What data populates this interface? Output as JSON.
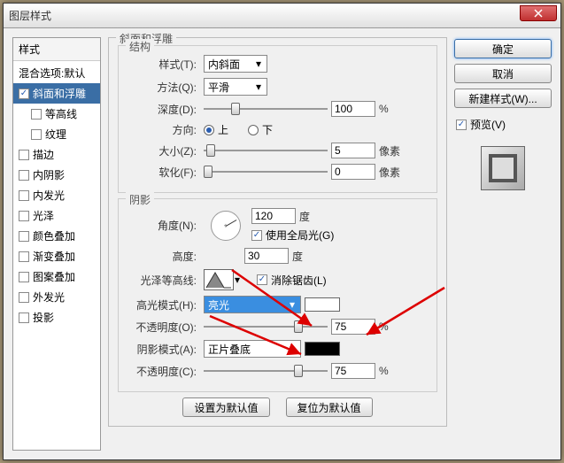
{
  "window": {
    "title": "图层样式"
  },
  "left": {
    "header": "样式",
    "items": [
      {
        "label": "混合选项:默认",
        "checked": false,
        "hasCheck": false
      },
      {
        "label": "斜面和浮雕",
        "checked": true,
        "hasCheck": true,
        "selected": true
      },
      {
        "label": "等高线",
        "checked": false,
        "hasCheck": true,
        "indent": true
      },
      {
        "label": "纹理",
        "checked": false,
        "hasCheck": true,
        "indent": true
      },
      {
        "label": "描边",
        "checked": false,
        "hasCheck": true
      },
      {
        "label": "内阴影",
        "checked": false,
        "hasCheck": true
      },
      {
        "label": "内发光",
        "checked": false,
        "hasCheck": true
      },
      {
        "label": "光泽",
        "checked": false,
        "hasCheck": true
      },
      {
        "label": "颜色叠加",
        "checked": false,
        "hasCheck": true
      },
      {
        "label": "渐变叠加",
        "checked": false,
        "hasCheck": true
      },
      {
        "label": "图案叠加",
        "checked": false,
        "hasCheck": true
      },
      {
        "label": "外发光",
        "checked": false,
        "hasCheck": true
      },
      {
        "label": "投影",
        "checked": false,
        "hasCheck": true
      }
    ]
  },
  "main": {
    "title": "斜面和浮雕",
    "structure": {
      "legend": "结构",
      "style_label": "样式(T):",
      "style_value": "内斜面",
      "method_label": "方法(Q):",
      "method_value": "平滑",
      "depth_label": "深度(D):",
      "depth_value": "100",
      "depth_unit": "%",
      "dir_label": "方向:",
      "dir_up": "上",
      "dir_down": "下",
      "size_label": "大小(Z):",
      "size_value": "5",
      "size_unit": "像素",
      "soften_label": "软化(F):",
      "soften_value": "0",
      "soften_unit": "像素"
    },
    "shading": {
      "legend": "阴影",
      "angle_label": "角度(N):",
      "angle_value": "120",
      "angle_unit": "度",
      "global_light": "使用全局光(G)",
      "global_checked": true,
      "altitude_label": "高度:",
      "altitude_value": "30",
      "altitude_unit": "度",
      "gloss_label": "光泽等高线:",
      "antialias": "消除锯齿(L)",
      "antialias_checked": true,
      "hl_mode_label": "高光模式(H):",
      "hl_mode_value": "亮光",
      "hl_color": "#ffffff",
      "hl_opacity_label": "不透明度(O):",
      "hl_opacity_value": "75",
      "hl_opacity_unit": "%",
      "sh_mode_label": "阴影模式(A):",
      "sh_mode_value": "正片叠底",
      "sh_color": "#000000",
      "sh_opacity_label": "不透明度(C):",
      "sh_opacity_value": "75",
      "sh_opacity_unit": "%"
    },
    "reset_default": "设置为默认值",
    "restore_default": "复位为默认值"
  },
  "right": {
    "ok": "确定",
    "cancel": "取消",
    "new_style": "新建样式(W)...",
    "preview": "预览(V)"
  }
}
